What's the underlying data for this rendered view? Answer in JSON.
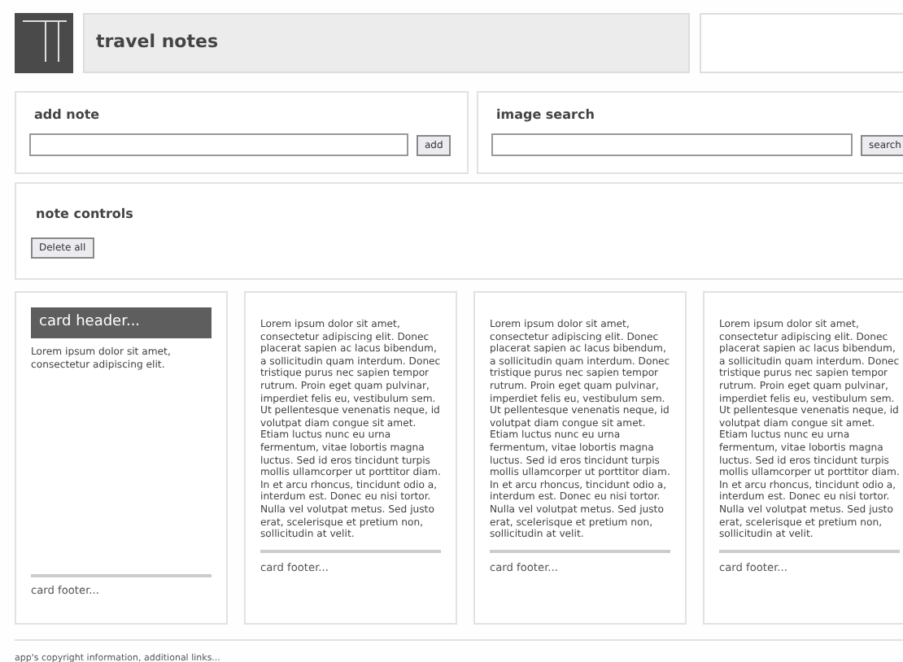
{
  "header": {
    "title": "travel notes"
  },
  "add_note": {
    "title": "add note",
    "button": "add"
  },
  "image_search": {
    "title": "image search",
    "button": "search"
  },
  "note_controls": {
    "title": "note controls",
    "button": "Delete all"
  },
  "cards": [
    {
      "kind": "header",
      "header": "card header...",
      "body": "Lorem ipsum dolor sit amet, consectetur adipiscing elit.",
      "footer": "card footer..."
    },
    {
      "kind": "plain",
      "body": "Lorem ipsum dolor sit amet, consectetur adipiscing elit. Donec placerat sapien ac lacus bibendum, a sollicitudin quam interdum. Donec tristique purus nec sapien tempor rutrum. Proin eget quam pulvinar, imperdiet felis eu, vestibulum sem. Ut pellentesque venenatis neque, id volutpat diam congue sit amet. Etiam luctus nunc eu urna fermentum, vitae lobortis magna luctus. Sed id eros tincidunt turpis mollis ullamcorper ut porttitor diam. In et arcu rhoncus, tincidunt odio a, interdum est. Donec eu nisi tortor. Nulla vel volutpat metus. Sed justo erat, scelerisque et pretium non, sollicitudin at velit.",
      "footer": "card footer..."
    },
    {
      "kind": "plain",
      "body": "Lorem ipsum dolor sit amet, consectetur adipiscing elit. Donec placerat sapien ac lacus bibendum, a sollicitudin quam interdum. Donec tristique purus nec sapien tempor rutrum. Proin eget quam pulvinar, imperdiet felis eu, vestibulum sem. Ut pellentesque venenatis neque, id volutpat diam congue sit amet. Etiam luctus nunc eu urna fermentum, vitae lobortis magna luctus. Sed id eros tincidunt turpis mollis ullamcorper ut porttitor diam. In et arcu rhoncus, tincidunt odio a, interdum est. Donec eu nisi tortor. Nulla vel volutpat metus. Sed justo erat, scelerisque et pretium non, sollicitudin at velit.",
      "footer": "card footer..."
    },
    {
      "kind": "plain",
      "body": "Lorem ipsum dolor sit amet, consectetur adipiscing elit. Donec placerat sapien ac lacus bibendum, a sollicitudin quam interdum. Donec tristique purus nec sapien tempor rutrum. Proin eget quam pulvinar, imperdiet felis eu, vestibulum sem. Ut pellentesque venenatis neque, id volutpat diam congue sit amet. Etiam luctus nunc eu urna fermentum, vitae lobortis magna luctus. Sed id eros tincidunt turpis mollis ullamcorper ut porttitor diam. In et arcu rhoncus, tincidunt odio a, interdum est. Donec eu nisi tortor. Nulla vel volutpat metus. Sed justo erat, scelerisque et pretium non, sollicitudin at velit.",
      "footer": "card footer..."
    }
  ],
  "footer": "app's copyright information, additional links..."
}
